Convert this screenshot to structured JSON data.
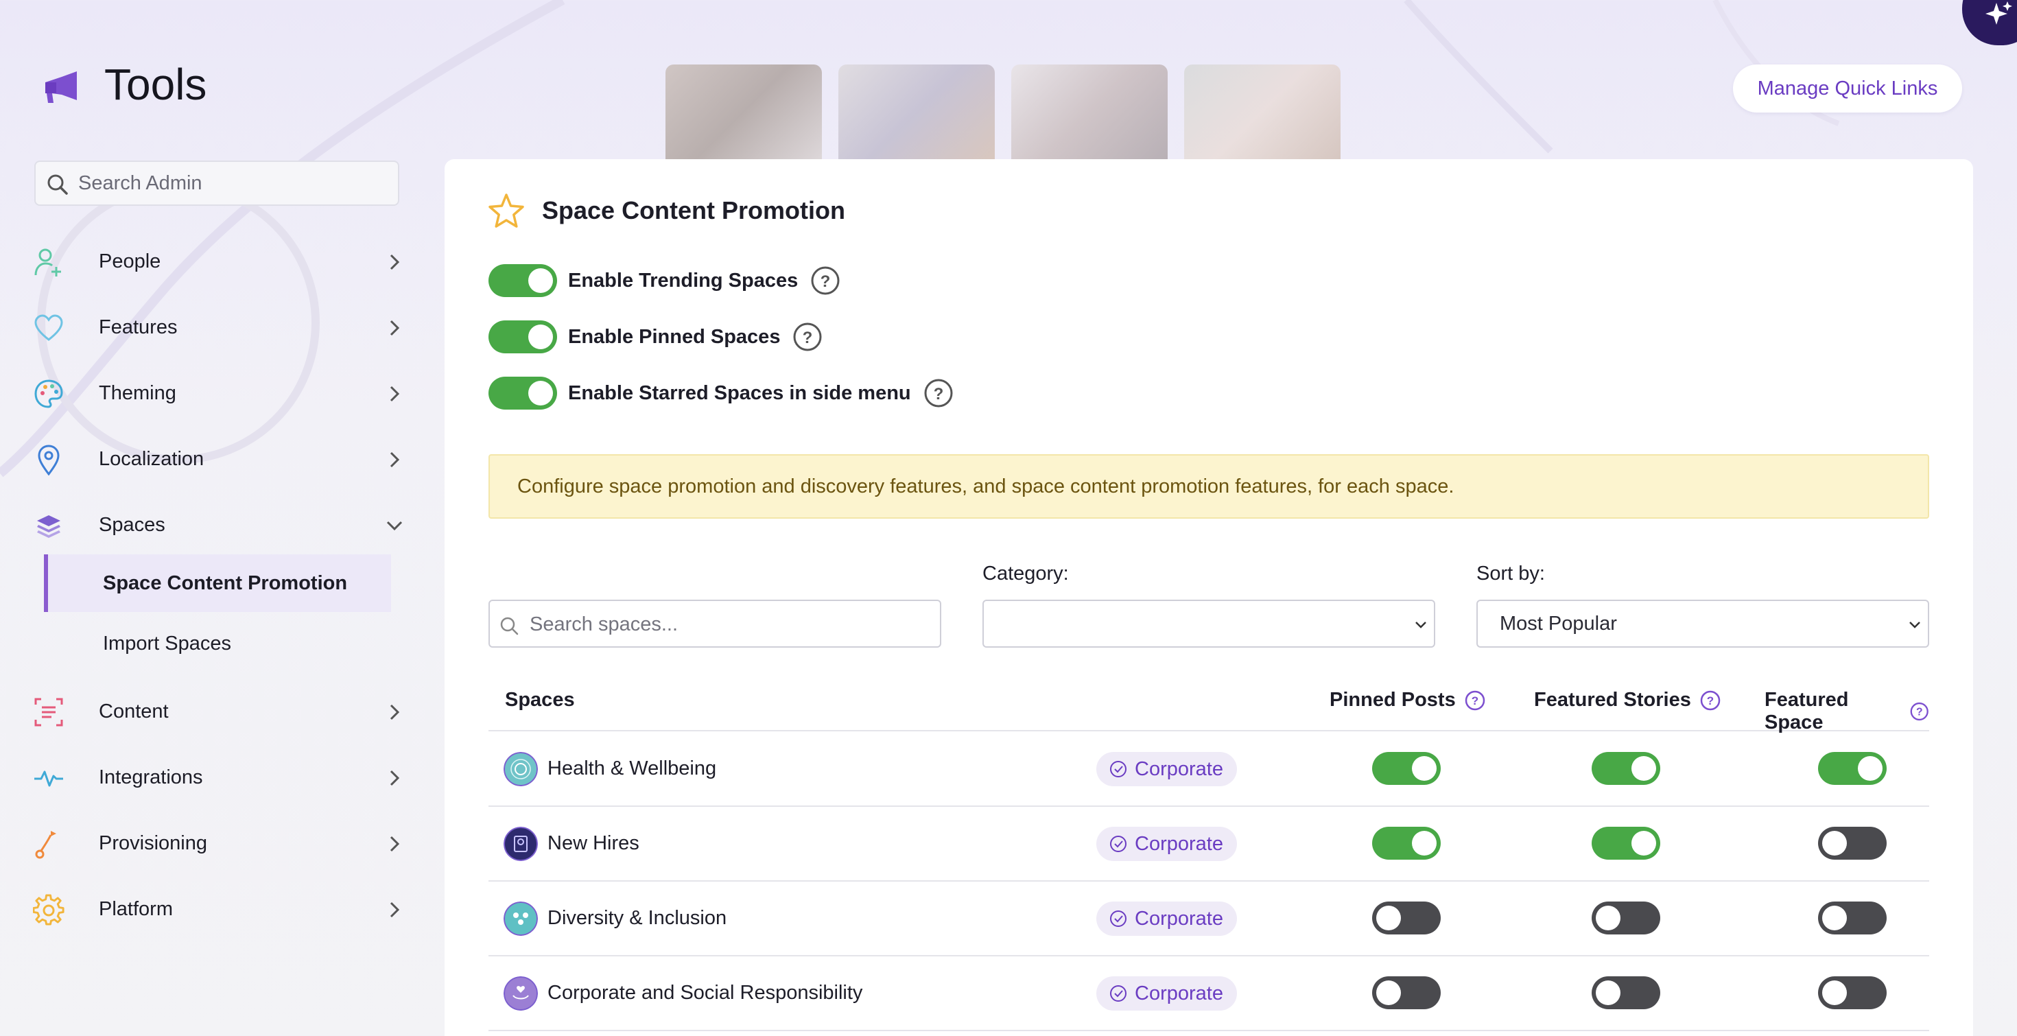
{
  "header": {
    "title": "Tools",
    "manage_quick_links": "Manage Quick Links"
  },
  "sidebar": {
    "search_placeholder": "Search Admin",
    "items": [
      {
        "label": "People",
        "icon": "person-add-icon"
      },
      {
        "label": "Features",
        "icon": "heart-icon"
      },
      {
        "label": "Theming",
        "icon": "palette-icon"
      },
      {
        "label": "Localization",
        "icon": "location-pin-icon"
      },
      {
        "label": "Spaces",
        "icon": "layers-icon",
        "expanded": true
      },
      {
        "label": "Content",
        "icon": "content-scan-icon"
      },
      {
        "label": "Integrations",
        "icon": "pulse-icon"
      },
      {
        "label": "Provisioning",
        "icon": "route-icon"
      },
      {
        "label": "Platform",
        "icon": "gear-icon"
      }
    ],
    "spaces_children": [
      {
        "label": "Space Content Promotion",
        "active": true
      },
      {
        "label": "Import Spaces",
        "active": false
      }
    ]
  },
  "panel": {
    "title": "Space Content Promotion",
    "settings": [
      {
        "label": "Enable Trending Spaces",
        "enabled": true
      },
      {
        "label": "Enable Pinned Spaces",
        "enabled": true
      },
      {
        "label": "Enable Starred Spaces in side menu",
        "enabled": true
      }
    ],
    "notice": "Configure space promotion and discovery features, and space content promotion features, for each space.",
    "search_placeholder": "Search spaces...",
    "category_label": "Category:",
    "category_value": "",
    "sort_label": "Sort by:",
    "sort_value": "Most Popular"
  },
  "table": {
    "columns": {
      "spaces": "Spaces",
      "pinned_posts": "Pinned Posts",
      "featured_stories": "Featured Stories",
      "featured_space": "Featured Space"
    },
    "rows": [
      {
        "name": "Health & Wellbeing",
        "category": "Corporate",
        "pinned_posts": true,
        "featured_stories": true,
        "featured_space": true
      },
      {
        "name": "New Hires",
        "category": "Corporate",
        "pinned_posts": true,
        "featured_stories": true,
        "featured_space": false
      },
      {
        "name": "Diversity & Inclusion",
        "category": "Corporate",
        "pinned_posts": false,
        "featured_stories": false,
        "featured_space": false
      },
      {
        "name": "Corporate and Social Responsibility",
        "category": "Corporate",
        "pinned_posts": false,
        "featured_stories": false,
        "featured_space": false
      }
    ]
  },
  "colors": {
    "accent": "#6a3cc2",
    "toggle_on": "#48a846",
    "toggle_off": "#4a4a4e",
    "notice_bg": "#fcf4cf"
  }
}
